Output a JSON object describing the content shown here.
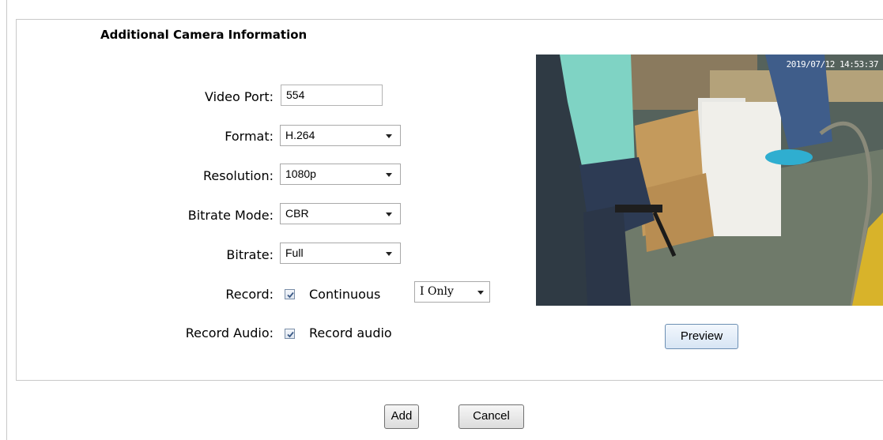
{
  "section": {
    "title": "Additional Camera Information"
  },
  "fields": {
    "video_port": {
      "label": "Video Port:",
      "value": "554"
    },
    "format": {
      "label": "Format:",
      "value": "H.264"
    },
    "resolution": {
      "label": "Resolution:",
      "value": "1080p"
    },
    "bitrate_mode": {
      "label": "Bitrate Mode:",
      "value": "CBR"
    },
    "bitrate": {
      "label": "Bitrate:",
      "value": "Full"
    },
    "record": {
      "label": "Record:",
      "checkbox_label": "Continuous",
      "checked": true,
      "frames_value": "I Only"
    },
    "record_audio": {
      "label": "Record Audio:",
      "checkbox_label": "Record audio",
      "checked": true
    }
  },
  "video": {
    "timestamp": "2019/07/12 14:53:37"
  },
  "buttons": {
    "preview": "Preview",
    "add": "Add",
    "cancel": "Cancel"
  },
  "colors": {
    "panel_border": "#c9c9c9",
    "checkbox_border": "#7a8ea8",
    "check_mark": "#3c5a86"
  }
}
